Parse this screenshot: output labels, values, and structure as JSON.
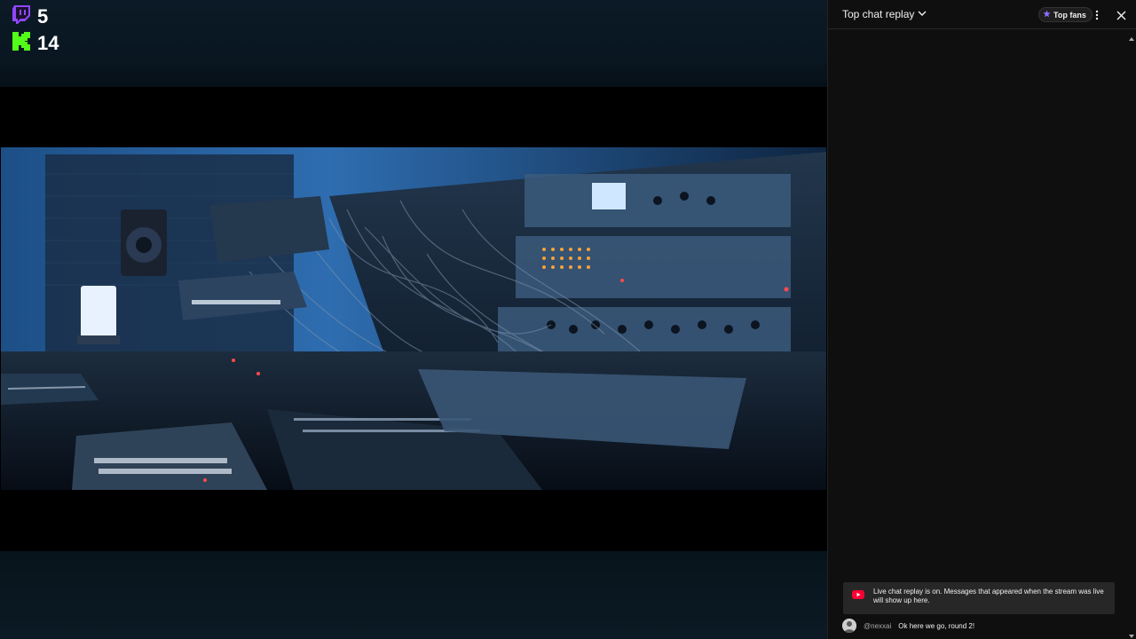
{
  "viewers": {
    "twitch_count": "5",
    "kick_count": "14"
  },
  "chat": {
    "title": "Top chat replay",
    "top_fans_label": "Top fans",
    "notice": "Live chat replay is on. Messages that appeared when the stream was live will show up here.",
    "messages": [
      {
        "author": "@nexxai",
        "text": "Ok here we go, round 2!"
      }
    ]
  },
  "colors": {
    "twitch": "#9146ff",
    "kick": "#53fc18",
    "youtube": "#ff0033"
  }
}
